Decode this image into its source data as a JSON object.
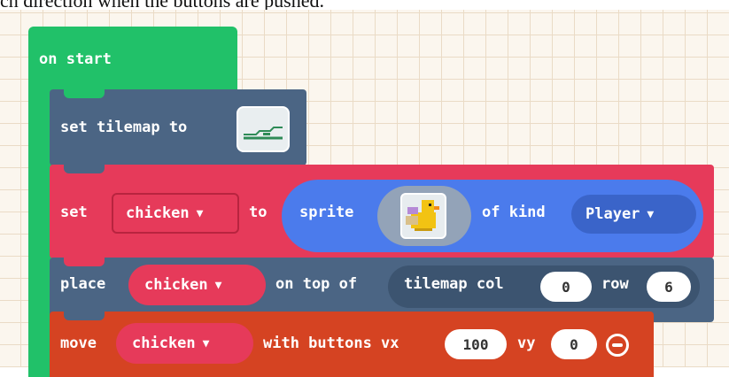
{
  "caption": "ch direction when the buttons are pushed.",
  "colors": {
    "loops_green": "#21c169",
    "scene_blue": "#4b6584",
    "sprites_red": "#e63a5a",
    "sprites_blue": "#4b7bec",
    "controller_orange": "#d54322"
  },
  "on_start": {
    "label": "on start"
  },
  "set_tilemap": {
    "label": "set tilemap to",
    "icon": "tilemap-thumbnail-icon"
  },
  "set_sprite": {
    "set_label": "set",
    "variable": "chicken",
    "to_label": "to",
    "sprite_label": "sprite",
    "sprite_icon": "duck-sprite-icon",
    "of_kind_label": "of kind",
    "kind": "Player"
  },
  "place": {
    "place_label": "place",
    "variable": "chicken",
    "on_top_label": "on top of",
    "tilemap_col_label": "tilemap col",
    "col": "0",
    "row_label": "row",
    "row": "6"
  },
  "move": {
    "move_label": "move",
    "variable": "chicken",
    "with_buttons_label": "with buttons vx",
    "vx": "100",
    "vy_label": "vy",
    "vy": "0",
    "remove_icon": "minus-circle-icon"
  }
}
